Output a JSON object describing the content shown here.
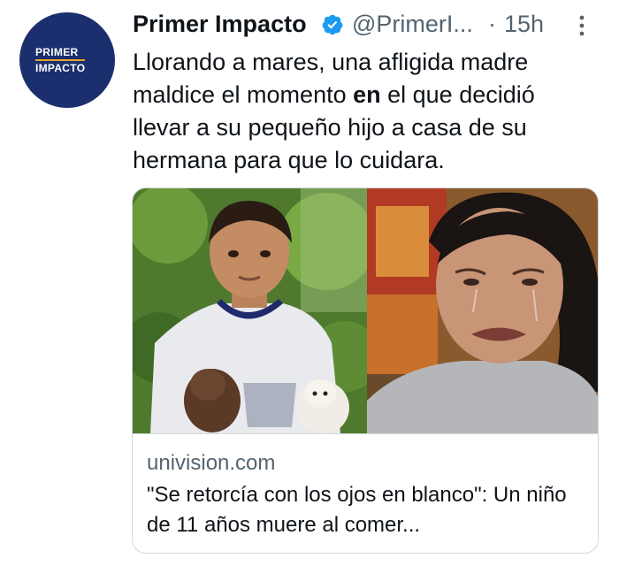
{
  "account": {
    "display_name": "Primer Impacto",
    "handle": "@PrimerI...",
    "separator": "·",
    "time_ago": "15h",
    "avatar_line1": "PRIMER",
    "avatar_line2": "IMPACTO",
    "verified_icon": "verified-badge-icon",
    "verified_color": "#1d9bf0"
  },
  "tweet": {
    "text_before": "Llorando a mares, una afligida madre maldice el momento ",
    "text_bold": "en",
    "text_after": " el que decidió llevar a su pequeño hijo a casa de su hermana para que lo cuidara."
  },
  "link_card": {
    "domain": "univision.com",
    "title": "\"Se retorcía con los ojos en blanco\": Un niño de 11 años muere al comer..."
  },
  "colors": {
    "avatar_bg": "#1b2e6e",
    "avatar_accent": "#e7a52a",
    "muted_text": "#536471",
    "border": "#cfd9de"
  }
}
